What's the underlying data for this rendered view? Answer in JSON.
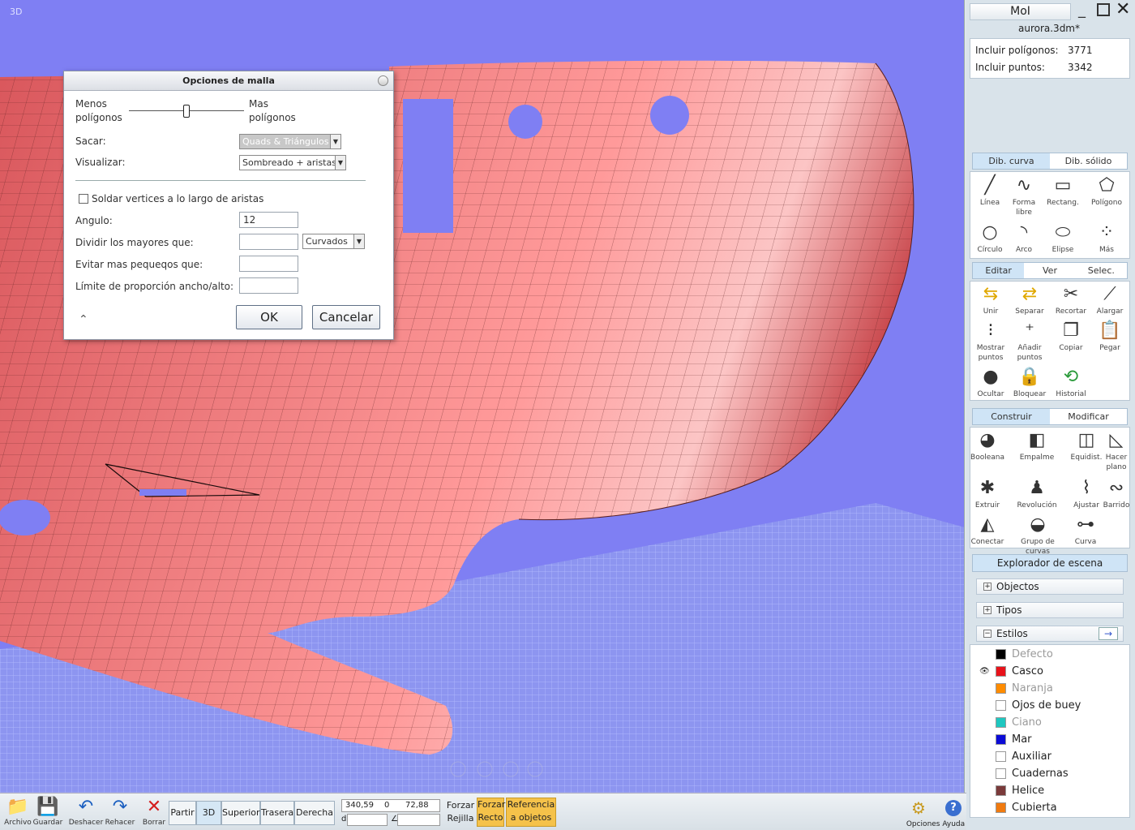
{
  "viewport": {
    "label": "3D"
  },
  "dialog": {
    "title": "Opciones de malla",
    "less_polys_1": "Menos",
    "less_polys_2": "polígonos",
    "more_polys_1": "Mas",
    "more_polys_2": "polígonos",
    "output_label": "Sacar:",
    "output_value": "Quads & Triángulos",
    "display_label": "Visualizar:",
    "display_value": "Sombreado + aristas",
    "weld_label": "Soldar vertices a lo largo de aristas",
    "angle_label": "Angulo:",
    "angle_value": "12",
    "divide_label": "Dividir los mayores que:",
    "divide_value": "",
    "divide_mode": "Curvados",
    "avoid_label": "Evitar mas pequeqos que:",
    "avoid_value": "",
    "ratio_label": "Límite de proporción ancho/alto:",
    "ratio_value": "",
    "ok": "OK",
    "cancel": "Cancelar"
  },
  "panel": {
    "app_name": "MoI",
    "file_name": "aurora.3dm*",
    "include_polys_label": "Incluir polígonos:",
    "include_polys_value": "3771",
    "include_points_label": "Incluir puntos:",
    "include_points_value": "3342",
    "draw_tabs": [
      "Dib. curva",
      "Dib. sólido"
    ],
    "draw_tools": [
      "Línea",
      "Forma libre",
      "Rectang.",
      "Polígono",
      "Círculo",
      "Arco",
      "Elipse",
      "Más"
    ],
    "edit_tabs": [
      "Editar",
      "Ver",
      "Selec."
    ],
    "edit_tools": [
      "Unir",
      "Separar",
      "Recortar",
      "Alargar",
      "Mostrar puntos",
      "Añadir puntos",
      "Copiar",
      "Pegar",
      "Ocultar",
      "Bloquear",
      "Historial"
    ],
    "construct_tabs": [
      "Construir",
      "Modificar"
    ],
    "construct_tools": [
      "Booleana",
      "Empalme",
      "Equidist.",
      "Hacer plano",
      "Extruir",
      "Revolución",
      "Ajustar",
      "Barrido",
      "Conectar",
      "Grupo de curvas",
      "Curva"
    ],
    "explorer_title": "Explorador de escena",
    "tree": [
      "Objectos",
      "Tipos",
      "Estilos"
    ],
    "styles": [
      {
        "name": "Defecto",
        "color": "#000000",
        "dim": true
      },
      {
        "name": "Casco",
        "color": "#e8121a",
        "dim": false
      },
      {
        "name": "Naranja",
        "color": "#ff8c00",
        "dim": true
      },
      {
        "name": "Ojos de buey",
        "color": "#ffffff",
        "dim": false
      },
      {
        "name": "Ciano",
        "color": "#1fc7c0",
        "dim": true
      },
      {
        "name": "Mar",
        "color": "#0b0bd6",
        "dim": false
      },
      {
        "name": "Auxiliar",
        "color": "#ffffff",
        "dim": false
      },
      {
        "name": "Cuadernas",
        "color": "#ffffff",
        "dim": false
      },
      {
        "name": "Helice",
        "color": "#7a3a3a",
        "dim": false
      },
      {
        "name": "Cubierta",
        "color": "#f07a10",
        "dim": false
      }
    ]
  },
  "bottom": {
    "file_tools": [
      "Archivo",
      "Guardar",
      "Deshacer",
      "Rehacer",
      "Borrar"
    ],
    "views": [
      "Partir",
      "3D",
      "Superior",
      "Trasera",
      "Derecha"
    ],
    "coord_x": "340,59",
    "coord_y": "0",
    "coord_z": "72,88",
    "coord_d_prefix": "d",
    "grid_snap_1": "Forzar",
    "grid_snap_2": "Rejilla",
    "straight_snap_1": "Forzar",
    "straight_snap_2": "Recto",
    "obj_snap_1": "Referencia",
    "obj_snap_2": "a objetos",
    "options_help": "Opciones Ayuda"
  }
}
